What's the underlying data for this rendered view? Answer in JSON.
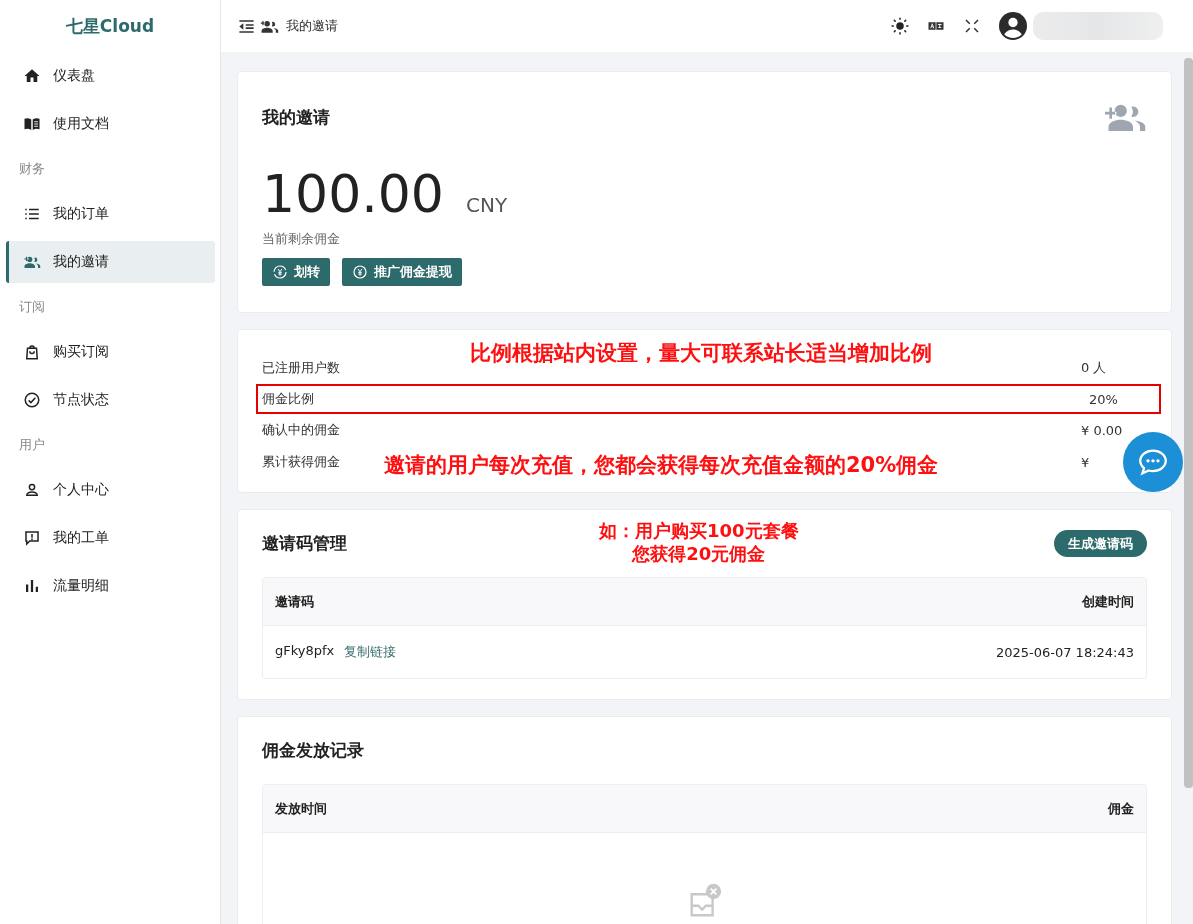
{
  "brand": {
    "name": "七星Cloud"
  },
  "header": {
    "breadcrumb": "我的邀请"
  },
  "sidebar": {
    "items": [
      {
        "kind": "item",
        "label": "仪表盘",
        "selected": false
      },
      {
        "kind": "item",
        "label": "使用文档",
        "selected": false
      },
      {
        "kind": "section",
        "label": "财务"
      },
      {
        "kind": "item",
        "label": "我的订单",
        "selected": false
      },
      {
        "kind": "item",
        "label": "我的邀请",
        "selected": true
      },
      {
        "kind": "section",
        "label": "订阅"
      },
      {
        "kind": "item",
        "label": "购买订阅",
        "selected": false
      },
      {
        "kind": "item",
        "label": "节点状态",
        "selected": false
      },
      {
        "kind": "section",
        "label": "用户"
      },
      {
        "kind": "item",
        "label": "个人中心",
        "selected": false
      },
      {
        "kind": "item",
        "label": "我的工单",
        "selected": false
      },
      {
        "kind": "item",
        "label": "流量明细",
        "selected": false
      }
    ]
  },
  "summary": {
    "title": "我的邀请",
    "amount": "100.00",
    "currency": "CNY",
    "caption": "当前剩余佣金",
    "buttons": [
      {
        "label": "划转"
      },
      {
        "label": "推广佣金提现"
      }
    ]
  },
  "stats": [
    {
      "label": "已注册用户数",
      "value": "0 人",
      "highlighted": false
    },
    {
      "label": "佣金比例",
      "value": "20%",
      "highlighted": true
    },
    {
      "label": "确认中的佣金",
      "value": "¥ 0.00",
      "highlighted": false
    },
    {
      "label": "累计获得佣金",
      "value": "¥",
      "highlighted": false
    }
  ],
  "annotations": [
    {
      "lines": [
        "比例根据站内设置，量大可联系站长适当增加比例"
      ]
    },
    {
      "lines": [
        "邀请的用户每次充值，您都会获得每次充值金额的20%佣金"
      ]
    },
    {
      "lines": [
        "如：用户购买100元套餐",
        "您获得20元佣金"
      ]
    }
  ],
  "invite_codes": {
    "title": "邀请码管理",
    "generate_button": "生成邀请码",
    "columns": [
      "邀请码",
      "创建时间"
    ],
    "rows": [
      {
        "code": "gFky8pfx",
        "copy_link": "复制链接",
        "created": "2025-06-07 18:24:43"
      }
    ]
  },
  "commission_records": {
    "title": "佣金发放记录",
    "columns": [
      "发放时间",
      "佣金"
    ]
  }
}
